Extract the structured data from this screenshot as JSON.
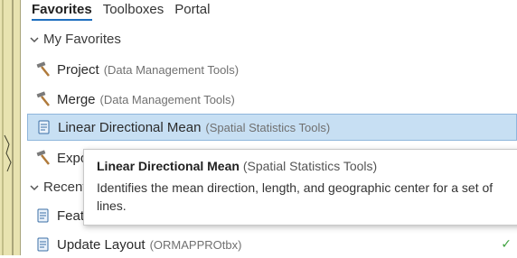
{
  "tabs": [
    {
      "label": "Favorites",
      "active": true
    },
    {
      "label": "Toolboxes",
      "active": false
    },
    {
      "label": "Portal",
      "active": false
    }
  ],
  "groups": {
    "my_favorites": "My Favorites",
    "recent": "Recent"
  },
  "items": [
    {
      "name": "Project",
      "source": "(Data Management Tools)",
      "icon": "hammer-icon"
    },
    {
      "name": "Merge",
      "source": "(Data Management Tools)",
      "icon": "hammer-icon"
    },
    {
      "name": "Linear Directional Mean",
      "source": "(Spatial Statistics Tools)",
      "icon": "script-icon",
      "selected": true
    },
    {
      "name": "Expo",
      "source": "",
      "icon": "hammer-icon"
    }
  ],
  "recent_items": [
    {
      "name": "Feat",
      "source": "",
      "icon": "script-icon"
    },
    {
      "name": "Update Layout",
      "source": "(ORMAPPROtbx)",
      "icon": "script-icon"
    }
  ],
  "tooltip": {
    "title": "Linear Directional Mean",
    "source": "(Spatial Statistics Tools)",
    "description": "Identifies the mean direction, length, and geographic center for a set of lines."
  },
  "status": {
    "check_icon": "check-icon",
    "check_glyph": "✓"
  },
  "colors": {
    "accent": "#1e6fbf",
    "selected_bg": "#c7dff3",
    "map_bg": "#e8e3b0"
  }
}
